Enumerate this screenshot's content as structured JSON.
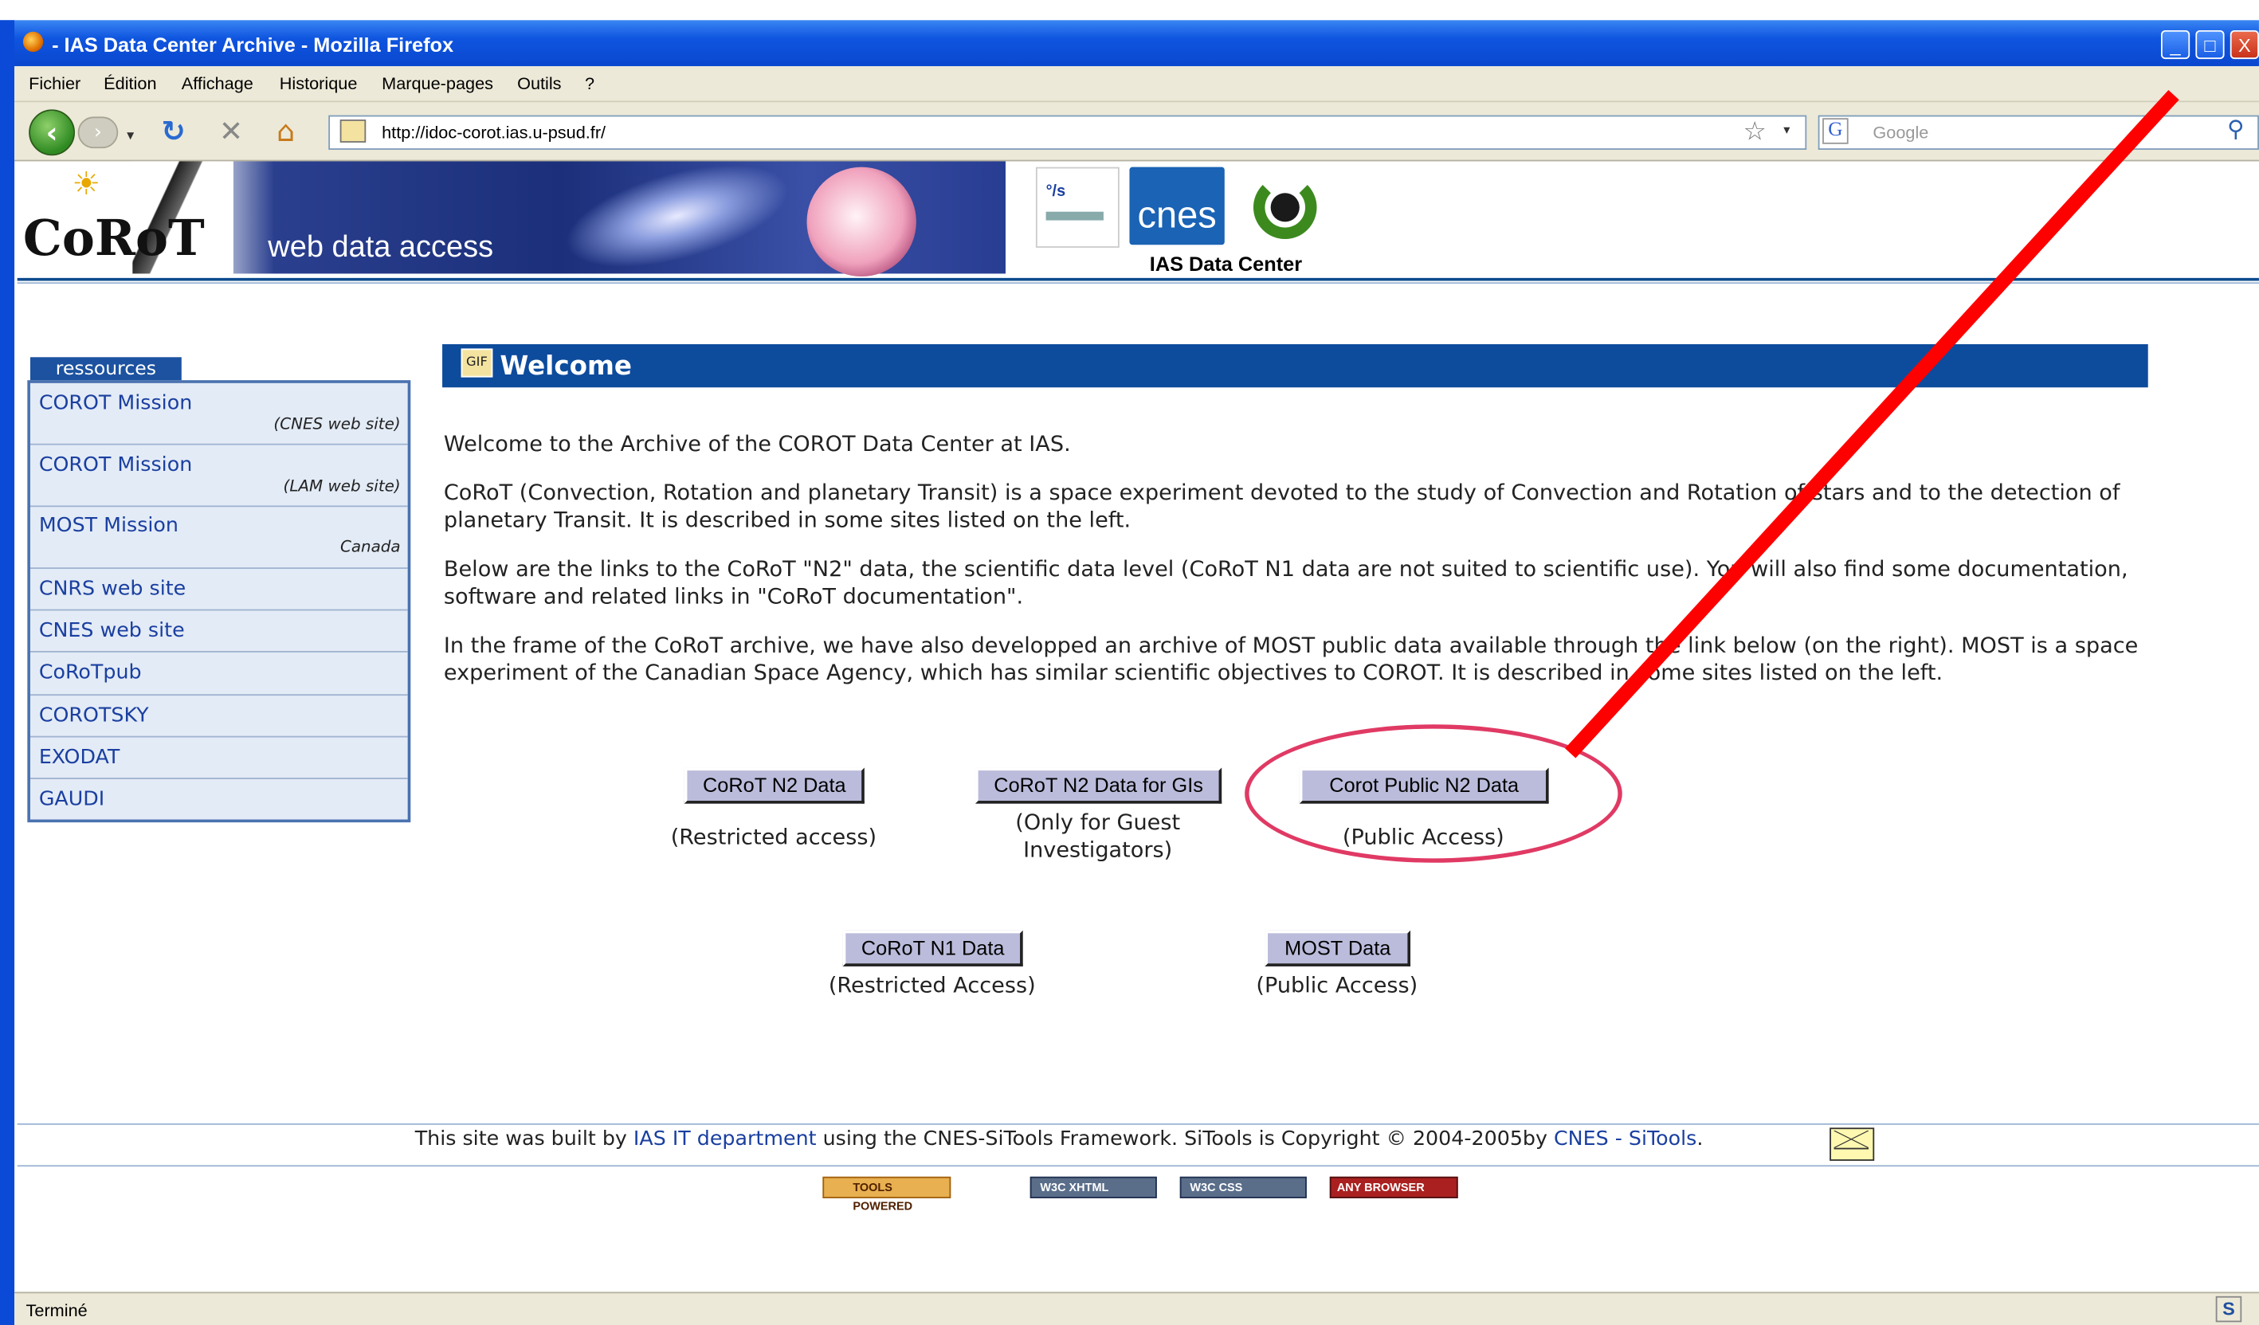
{
  "window": {
    "title": "- IAS Data Center Archive - Mozilla Firefox",
    "buttons": {
      "minimize": "_",
      "maximize": "□",
      "close": "X"
    }
  },
  "menu": [
    "Fichier",
    "Édition",
    "Affichage",
    "Historique",
    "Marque-pages",
    "Outils",
    "?"
  ],
  "nav": {
    "url": "http://idoc-corot.ias.u-psud.fr/",
    "search_placeholder": "Google",
    "search_engine_glyph": "G"
  },
  "banner": {
    "logo_text": "CoRoT",
    "subtitle": "web data access",
    "center_label": "IAS Data Center",
    "cnes_logo": "cnes"
  },
  "sidebar": {
    "tab": "ressources",
    "items": [
      {
        "label": "COROT Mission",
        "note": "(CNES web site)"
      },
      {
        "label": "COROT Mission",
        "note": "(LAM web site)"
      },
      {
        "label": "MOST Mission",
        "note": "Canada"
      },
      {
        "label": "CNRS web site"
      },
      {
        "label": "CNES web site"
      },
      {
        "label": "CoRoTpub"
      },
      {
        "label": "COROTSKY"
      },
      {
        "label": "EXODAT"
      },
      {
        "label": "GAUDI"
      }
    ]
  },
  "content": {
    "heading": "Welcome",
    "paragraphs": [
      "Welcome to the Archive of the COROT Data Center at IAS.",
      "CoRoT (Convection, Rotation and planetary Transit) is a space experiment devoted to the study of Convection and Rotation of stars and to the detection of planetary Transit. It is described in some sites listed on the left.",
      "Below are the links to the CoRoT \"N2\" data, the scientific data level (CoRoT N1 data are not suited to scientific use). You will also find some documentation, software and related links in \"CoRoT documentation\".",
      "In the frame of the CoRoT archive, we have also developped an archive of MOST public data available through the link below (on the right). MOST is a space experiment of the Canadian Space Agency, which has similar scientific objectives to COROT. It is described in some sites listed on the left."
    ],
    "buttons": [
      {
        "label": "CoRoT N2 Data",
        "caption": "(Restricted access)"
      },
      {
        "label": "CoRoT N2 Data for GIs",
        "caption": "(Only for Guest Investigators)"
      },
      {
        "label": "Corot Public N2 Data",
        "caption": "(Public Access)"
      },
      {
        "label": "CoRoT N1 Data",
        "caption": "(Restricted Access)"
      },
      {
        "label": "MOST Data",
        "caption": "(Public Access)"
      }
    ]
  },
  "footer": {
    "text_before": "This site was built by ",
    "link1": "IAS IT department",
    "text_middle": " using the CNES-SiTools Framework. SiTools is Copyright © 2004-2005by ",
    "link2": "CNES - SiTools",
    "text_after": ".",
    "badges": [
      "TOOLS POWERED",
      "W3C XHTML",
      "W3C CSS",
      "ANY BROWSER"
    ]
  },
  "status": {
    "text": "Terminé",
    "right_icon": "S"
  },
  "colors": {
    "header_blue": "#0d4b9c",
    "link": "#1a3fa0",
    "highlight_ellipse": "#e03a64",
    "arrow": "#ff0000",
    "button_face": "#bbbcdb"
  }
}
